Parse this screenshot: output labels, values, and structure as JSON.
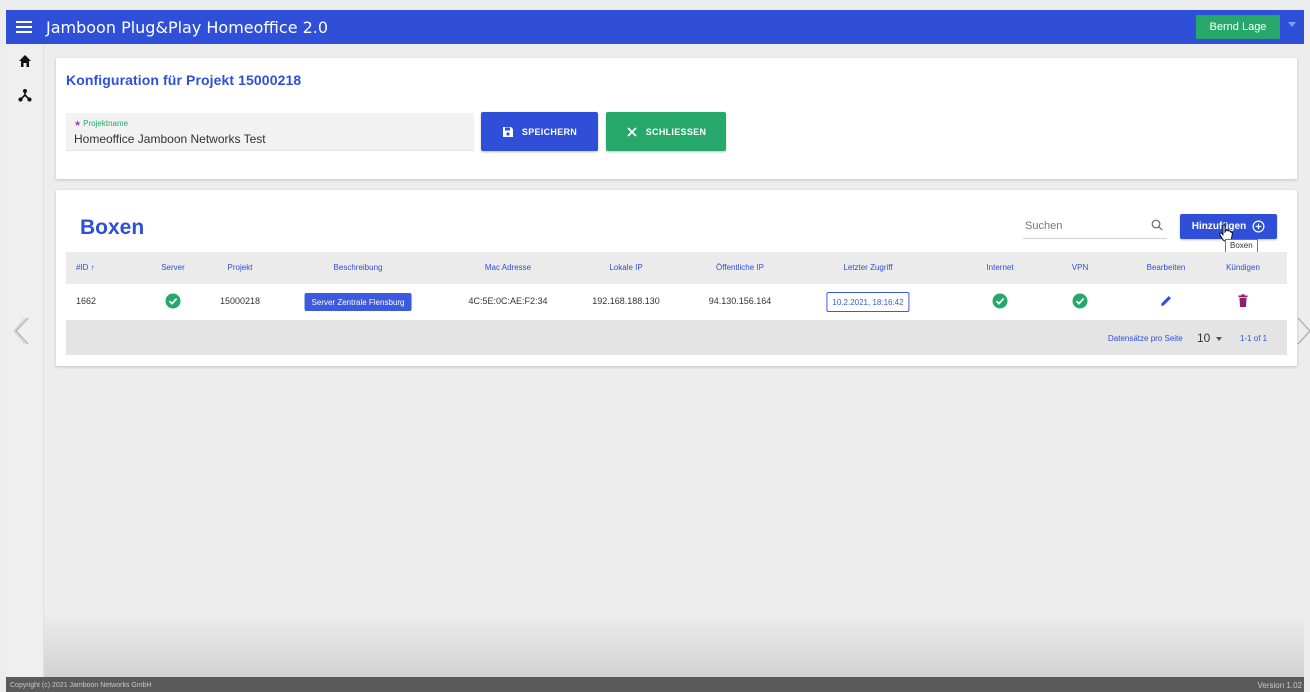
{
  "app": {
    "title": "Jamboon Plug&Play Homeoffice 2.0",
    "user": "Bernd Lage",
    "colors": {
      "primary": "#2f4fd9",
      "success": "#26a86a",
      "delete": "#8e1f6b"
    }
  },
  "rail": {
    "items": [
      {
        "icon": "home-icon"
      },
      {
        "icon": "network-icon"
      }
    ]
  },
  "config": {
    "title": "Konfiguration für Projekt 15000218",
    "field_label": "Projektname",
    "field_value": "Homeoffice Jamboon Networks Test",
    "save_label": "SPEICHERN",
    "close_label": "SCHLIESSEN"
  },
  "boxes": {
    "title": "Boxen",
    "search_placeholder": "Suchen",
    "add_label": "Hinzufügen",
    "tooltip": "Boxen",
    "columns": [
      "#ID ↑",
      "Server",
      "Projekt",
      "Beschreibung",
      "Mac Adresse",
      "Lokale IP",
      "Öffentliche IP",
      "Letzter Zugriff",
      "Internet",
      "VPN",
      "Bearbeiten",
      "Kündigen"
    ],
    "rows": [
      {
        "id": "1662",
        "server": "ok",
        "projekt": "15000218",
        "beschreibung": "Server Zentrale Flensburg",
        "mac": "4C:5E:0C:AE:F2:34",
        "lokale_ip": "192.168.188.130",
        "oeffentliche_ip": "94.130.156.164",
        "letzter_zugriff": "10.2.2021, 18:16:42",
        "internet": "ok",
        "vpn": "ok"
      }
    ],
    "pagination": {
      "label": "Datensätze pro Seite",
      "per_page": "10",
      "range": "1-1 of 1"
    }
  },
  "footer": {
    "copyright": "Copyright (c) 2021 Jamboon Networks GmbH",
    "version": "Version 1.02"
  }
}
